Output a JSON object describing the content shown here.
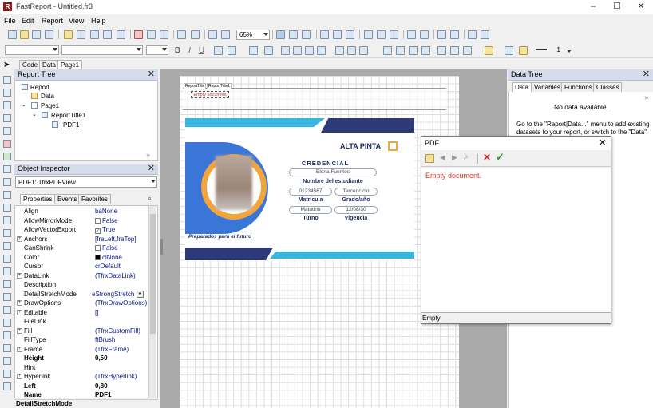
{
  "window": {
    "title": "FastReport - Untitled.fr3",
    "logo": "R",
    "min": "–",
    "max": "☐",
    "close": "✕"
  },
  "menu": [
    "File",
    "Edit",
    "Report",
    "View",
    "Help"
  ],
  "toolbar": {
    "zoom": "65%"
  },
  "format_bar": {
    "bold": "B",
    "italic": "I",
    "underline": "U",
    "frame_width": "1"
  },
  "designer_tabs": [
    "Code",
    "Data",
    "Page1"
  ],
  "report_tree": {
    "title": "Report Tree",
    "nodes": [
      "Report",
      "Data",
      "Page1",
      "ReportTitle1",
      "PDF1"
    ]
  },
  "inspector": {
    "title": "Object Inspector",
    "selected": "PDF1: TfrxPDFView",
    "tabs": [
      "Properties",
      "Events",
      "Favorites"
    ],
    "rows": [
      {
        "name": "Align",
        "value": "baNone"
      },
      {
        "name": "AllowMirrorMode",
        "value": "False",
        "check": ""
      },
      {
        "name": "AllowVectorExport",
        "value": "True",
        "check": "✓"
      },
      {
        "name": "Anchors",
        "value": "[fraLeft,fraTop]",
        "plus": "+"
      },
      {
        "name": "CanShrink",
        "value": "False",
        "check": ""
      },
      {
        "name": "Color",
        "value": "clNone",
        "swatch": "#000000"
      },
      {
        "name": "Cursor",
        "value": "crDefault"
      },
      {
        "name": "DataLink",
        "value": "(TfrxDataLink)",
        "plus": "+"
      },
      {
        "name": "Description",
        "value": ""
      },
      {
        "name": "DetailStretchMode",
        "value": "eStrongStretch"
      },
      {
        "name": "DrawOptions",
        "value": "(TfrxDrawOptions)",
        "plus": "+"
      },
      {
        "name": "Editable",
        "value": "[]",
        "plus": "+"
      },
      {
        "name": "FileLink",
        "value": ""
      },
      {
        "name": "Fill",
        "value": "(TfrxCustomFill)",
        "plus": "+"
      },
      {
        "name": "FillType",
        "value": "ftBrush"
      },
      {
        "name": "Frame",
        "value": "(TfrxFrame)",
        "plus": "+"
      },
      {
        "name": "Height",
        "value": "0,50",
        "bold": true
      },
      {
        "name": "Hint",
        "value": ""
      },
      {
        "name": "Hyperlink",
        "value": "(TfrxHyperlink)",
        "plus": "+"
      },
      {
        "name": "Left",
        "value": "0,80",
        "bold": true
      },
      {
        "name": "Name",
        "value": "PDF1",
        "bold": true
      },
      {
        "name": "Password",
        "value": ""
      }
    ],
    "status": "DetailStretchMode"
  },
  "page": {
    "band_tabs": [
      "ReportTitle",
      "ReportTitle1"
    ],
    "empty_label": "Empty document"
  },
  "card": {
    "brand": "ALTA PINTA",
    "heading": "CREDENCIAL",
    "name_value": "Elena Fuentes",
    "name_label": "Nombre del estudiante",
    "id_value": "01234567",
    "grade_value": "Tercer ciclo",
    "id_label": "Matrícula",
    "grade_label": "Grado/año",
    "shift_value": "Matutino",
    "date_value": "12/08/30",
    "shift_label": "Turno",
    "date_label": "Vigencia",
    "slogan": "Preparados para el futuro"
  },
  "data_tree": {
    "title": "Data Tree",
    "tabs": [
      "Data",
      "Variables",
      "Functions",
      "Classes"
    ],
    "empty": "No data available.",
    "hint": "Go to the \"Report|Data...\" menu to add existing datasets to your report, or switch to the \"Data\" tab to create new datasets.",
    "hint_visible": "ets."
  },
  "pdf_dialog": {
    "title": "PDF",
    "message": "Empty document.",
    "status": "Empty",
    "ok": "✓",
    "cancel": "✕"
  },
  "colors": {
    "accent": "#3a75d8",
    "dark": "#2e3a78",
    "cyan": "#38b6e0",
    "orange": "#f3a43a",
    "error": "#d23a2a"
  }
}
